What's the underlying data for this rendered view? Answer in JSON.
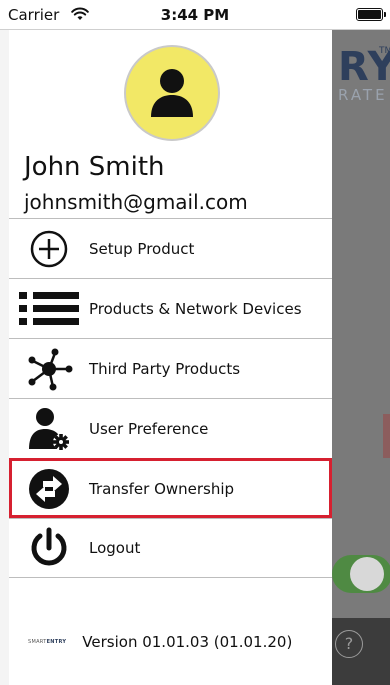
{
  "status_bar": {
    "carrier": "Carrier",
    "time": "3:44 PM",
    "wifi_icon": "wifi-icon",
    "battery_icon": "battery-icon"
  },
  "background": {
    "brand_text": "RY",
    "trademark": "TM",
    "brand_subtitle": "RATE",
    "help_label": "?"
  },
  "profile": {
    "avatar_icon": "person-icon",
    "name": "John Smith",
    "email": "johnsmith@gmail.com"
  },
  "menu": {
    "items": [
      {
        "label": "Setup Product",
        "icon": "plus-circle-icon"
      },
      {
        "label": "Products & Network Devices",
        "icon": "list-icon"
      },
      {
        "label": "Third Party Products",
        "icon": "network-nodes-icon"
      },
      {
        "label": "User Preference",
        "icon": "user-gear-icon"
      },
      {
        "label": "Transfer Ownership",
        "icon": "transfer-arrows-icon",
        "highlighted": true
      },
      {
        "label": "Logout",
        "icon": "power-icon"
      }
    ]
  },
  "footer": {
    "logo_text_light": "SMART",
    "logo_text_bold": "ENTRY",
    "version": "Version 01.01.03 (01.01.20)"
  },
  "colors": {
    "highlight": "#d62030",
    "avatar_bg": "#f2e866",
    "brand": "#2e3f5c",
    "toggle_on": "#4f8a43"
  }
}
